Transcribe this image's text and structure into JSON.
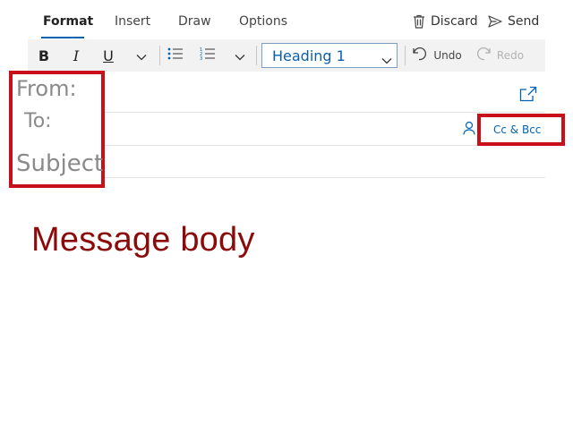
{
  "tabs": [
    {
      "label": "Format"
    },
    {
      "label": "Insert"
    },
    {
      "label": "Draw"
    },
    {
      "label": "Options"
    }
  ],
  "actions": {
    "discard_label": "Discard",
    "send_label": "Send"
  },
  "toolbar": {
    "bold": "B",
    "italic": "I",
    "underline": "U",
    "style_value": "Heading 1",
    "undo_label": "Undo",
    "redo_label": "Redo"
  },
  "fields": {
    "from_label": "From:",
    "to_label": "To:",
    "subject_label": "Subject",
    "cc_bcc_label": "Cc & Bcc"
  },
  "message": {
    "body": "Message body"
  },
  "colors": {
    "accent": "#0063b1",
    "annotation_red": "#c8101b",
    "body_text": "#8b0a0a"
  }
}
